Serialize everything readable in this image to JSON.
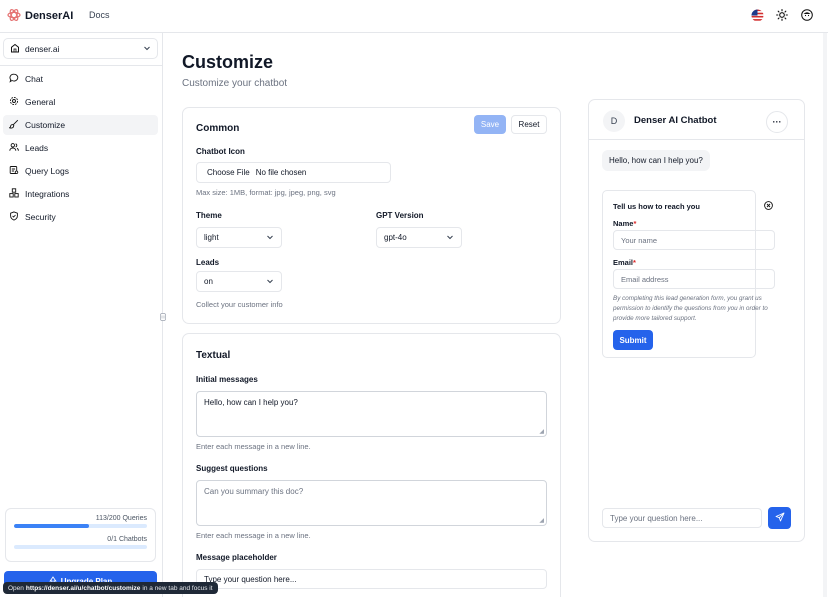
{
  "header": {
    "brand": "DenserAI",
    "docs": "Docs",
    "icons": [
      "flag-us-icon",
      "sun-icon",
      "user-avatar-icon"
    ]
  },
  "sidebar": {
    "org": "denser.ai",
    "items": [
      {
        "label": "Chat",
        "icon": "chat-icon"
      },
      {
        "label": "General",
        "icon": "gear-icon"
      },
      {
        "label": "Customize",
        "icon": "brush-icon",
        "active": true
      },
      {
        "label": "Leads",
        "icon": "users-icon"
      },
      {
        "label": "Query Logs",
        "icon": "logs-icon"
      },
      {
        "label": "Integrations",
        "icon": "integrations-icon"
      },
      {
        "label": "Security",
        "icon": "shield-icon"
      }
    ],
    "usage": {
      "queries_text": "113/200 Queries",
      "queries_fraction": 0.565,
      "chatbots_text": "0/1 Chatbots",
      "chatbots_fraction": 0
    },
    "upgrade_label": "Upgrade Plan"
  },
  "main": {
    "title": "Customize",
    "subtitle": "Customize your chatbot",
    "common": {
      "title": "Common",
      "save_label": "Save",
      "reset_label": "Reset",
      "icon_label": "Chatbot Icon",
      "choose_file": "Choose File",
      "no_file": "No file chosen",
      "icon_hint": "Max size: 1MB, format: jpg, jpeg, png, svg",
      "theme_label": "Theme",
      "theme_value": "light",
      "gpt_label": "GPT Version",
      "gpt_value": "gpt-4o",
      "leads_label": "Leads",
      "leads_value": "on",
      "leads_hint": "Collect your customer info"
    },
    "textual": {
      "title": "Textual",
      "initial_label": "Initial messages",
      "initial_value": "Hello, how can I help you?",
      "initial_hint": "Enter each message in a new line.",
      "suggest_label": "Suggest questions",
      "suggest_placeholder": "Can you summary this doc?",
      "suggest_hint": "Enter each message in a new line.",
      "placeholder_label": "Message placeholder",
      "placeholder_value": "Type your question here..."
    }
  },
  "chat": {
    "avatar_letter": "D",
    "name": "Denser AI Chatbot",
    "more": "···",
    "greeting": "Hello, how can I help you?",
    "lead_form": {
      "title": "Tell us how to reach you",
      "name_label": "Name",
      "name_placeholder": "Your name",
      "email_label": "Email",
      "email_placeholder": "Email address",
      "required_mark": "*",
      "note": "By completing this lead generation form, you grant us permission to identify the questions from you in order to provide more tailored support.",
      "submit": "Submit"
    },
    "input_placeholder": "Type your question here..."
  },
  "status_bar": {
    "prefix": "Open",
    "url": "https://denser.ai/u/chatbot/customize",
    "suffix": "in a new tab and focus it"
  }
}
